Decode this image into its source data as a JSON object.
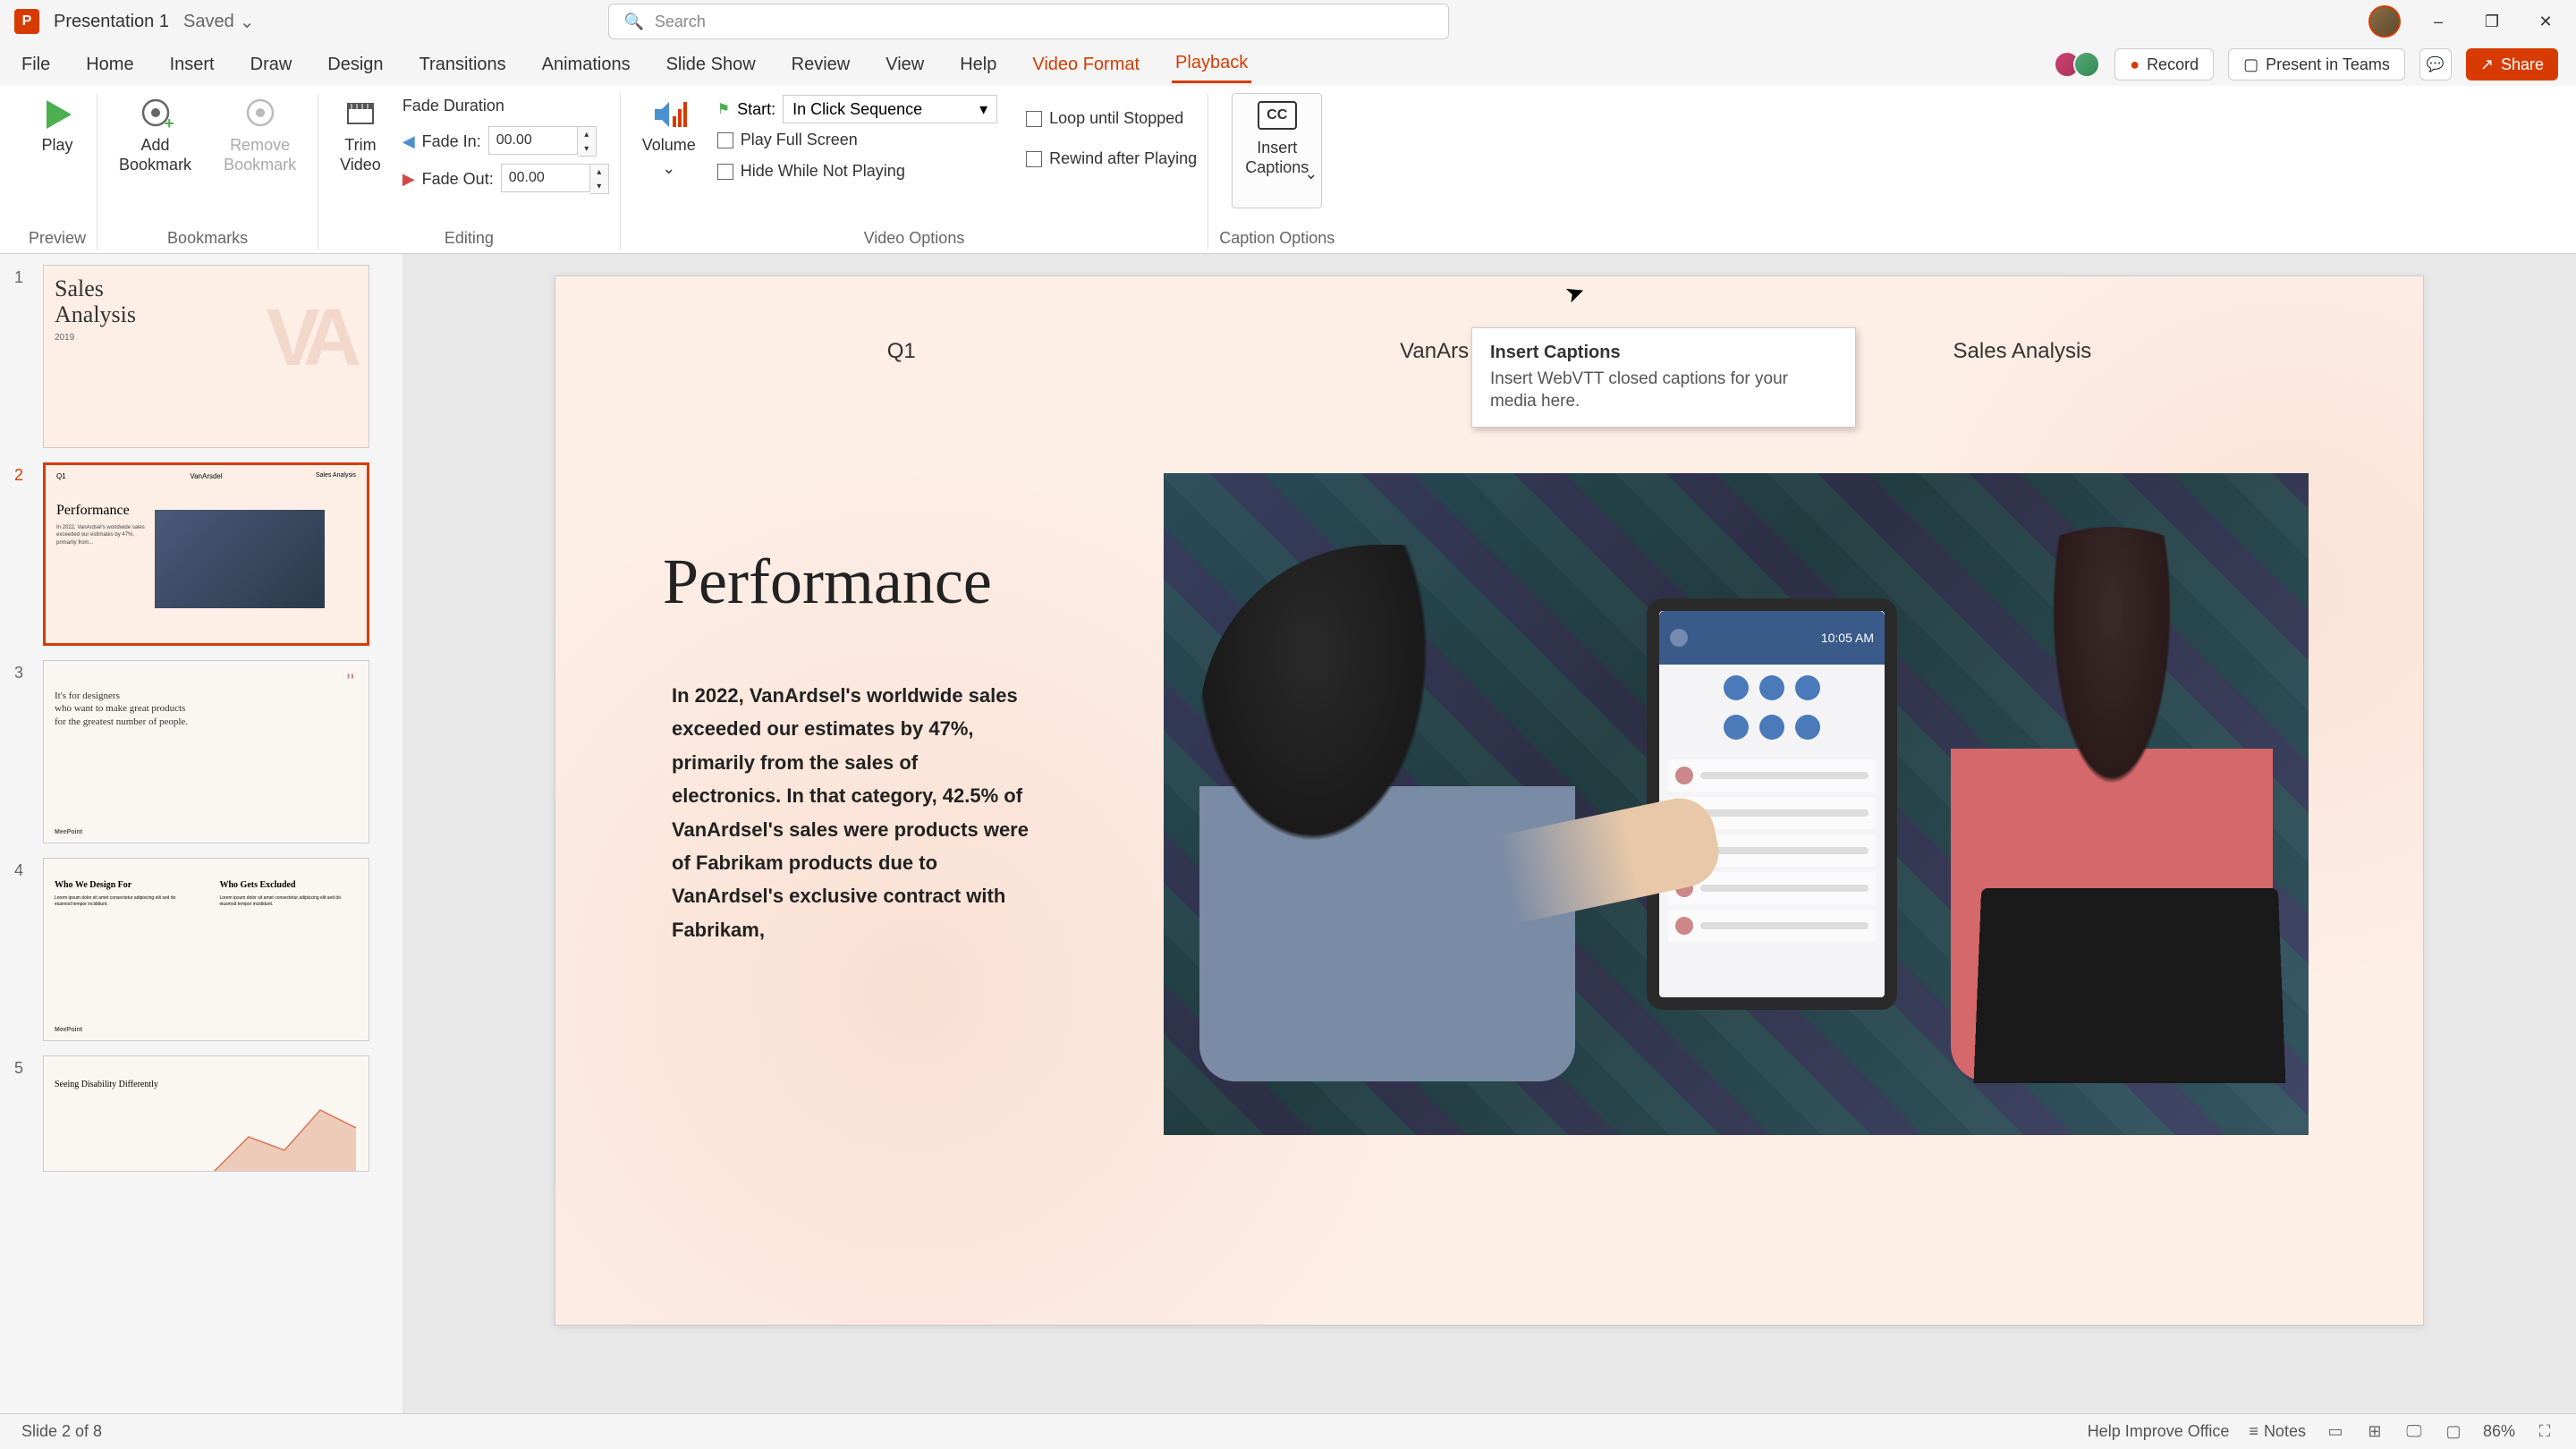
{
  "titlebar": {
    "app_letter": "P",
    "doc_title": "Presentation 1",
    "save_status": "Saved",
    "search_placeholder": "Search"
  },
  "window_controls": {
    "minimize": "–",
    "restore": "❐",
    "close": "✕"
  },
  "tabs": [
    "File",
    "Home",
    "Insert",
    "Draw",
    "Design",
    "Transitions",
    "Animations",
    "Slide Show",
    "Review",
    "View",
    "Help",
    "Video Format",
    "Playback"
  ],
  "active_tab_index": 12,
  "contextual_start_index": 11,
  "toolbar_right": {
    "record": "Record",
    "present_teams": "Present in Teams",
    "share": "Share"
  },
  "ribbon": {
    "preview": {
      "label": "Preview",
      "play": "Play"
    },
    "bookmarks": {
      "label": "Bookmarks",
      "add": "Add\nBookmark",
      "remove": "Remove\nBookmark"
    },
    "editing": {
      "label": "Editing",
      "trim": "Trim\nVideo",
      "fade_duration": "Fade Duration",
      "fade_in": "Fade In:",
      "fade_out": "Fade Out:",
      "fade_in_val": "00.00",
      "fade_out_val": "00.00"
    },
    "video_options": {
      "label": "Video Options",
      "volume": "Volume",
      "start": "Start:",
      "start_value": "In Click Sequence",
      "play_full": "Play Full Screen",
      "hide": "Hide While Not Playing",
      "loop": "Loop until Stopped",
      "rewind": "Rewind after Playing"
    },
    "caption_options": {
      "label": "Caption Options",
      "insert": "Insert\nCaptions",
      "cc": "CC"
    }
  },
  "tooltip": {
    "title": "Insert Captions",
    "desc": "Insert WebVTT closed captions for your media here."
  },
  "slides": {
    "count": 8,
    "current": 2,
    "thumbs": {
      "1": {
        "title": "Sales\nAnalysis",
        "year": "2019",
        "va": "VA"
      },
      "2": {
        "q": "Q1",
        "mid": "VanArsdel",
        "right": "Sales Analysis",
        "perf": "Performance"
      },
      "3": {
        "quote": "It's for designers\nwho want to make great products\nfor the greatest number of people.",
        "foot": "MeePoint"
      },
      "4": {
        "col1_h": "Who We Design For",
        "col2_h": "Who Gets Excluded",
        "foot": "MeePoint"
      },
      "5": {
        "title": "Seeing Disability Differently"
      }
    }
  },
  "slide_content": {
    "q": "Q1",
    "mid": "VanArs",
    "right": "Sales Analysis",
    "title": "Performance",
    "body": "In 2022, VanArdsel's worldwide sales exceeded our estimates by 47%, primarily from the sales of electronics. In that category, 42.5% of VanArdsel's sales were products were of Fabrikam products due to VanArdsel's exclusive contract with Fabrikam,"
  },
  "statusbar": {
    "slide_info": "Slide 2 of 8",
    "help": "Help Improve Office",
    "notes": "Notes",
    "zoom": "86%"
  }
}
